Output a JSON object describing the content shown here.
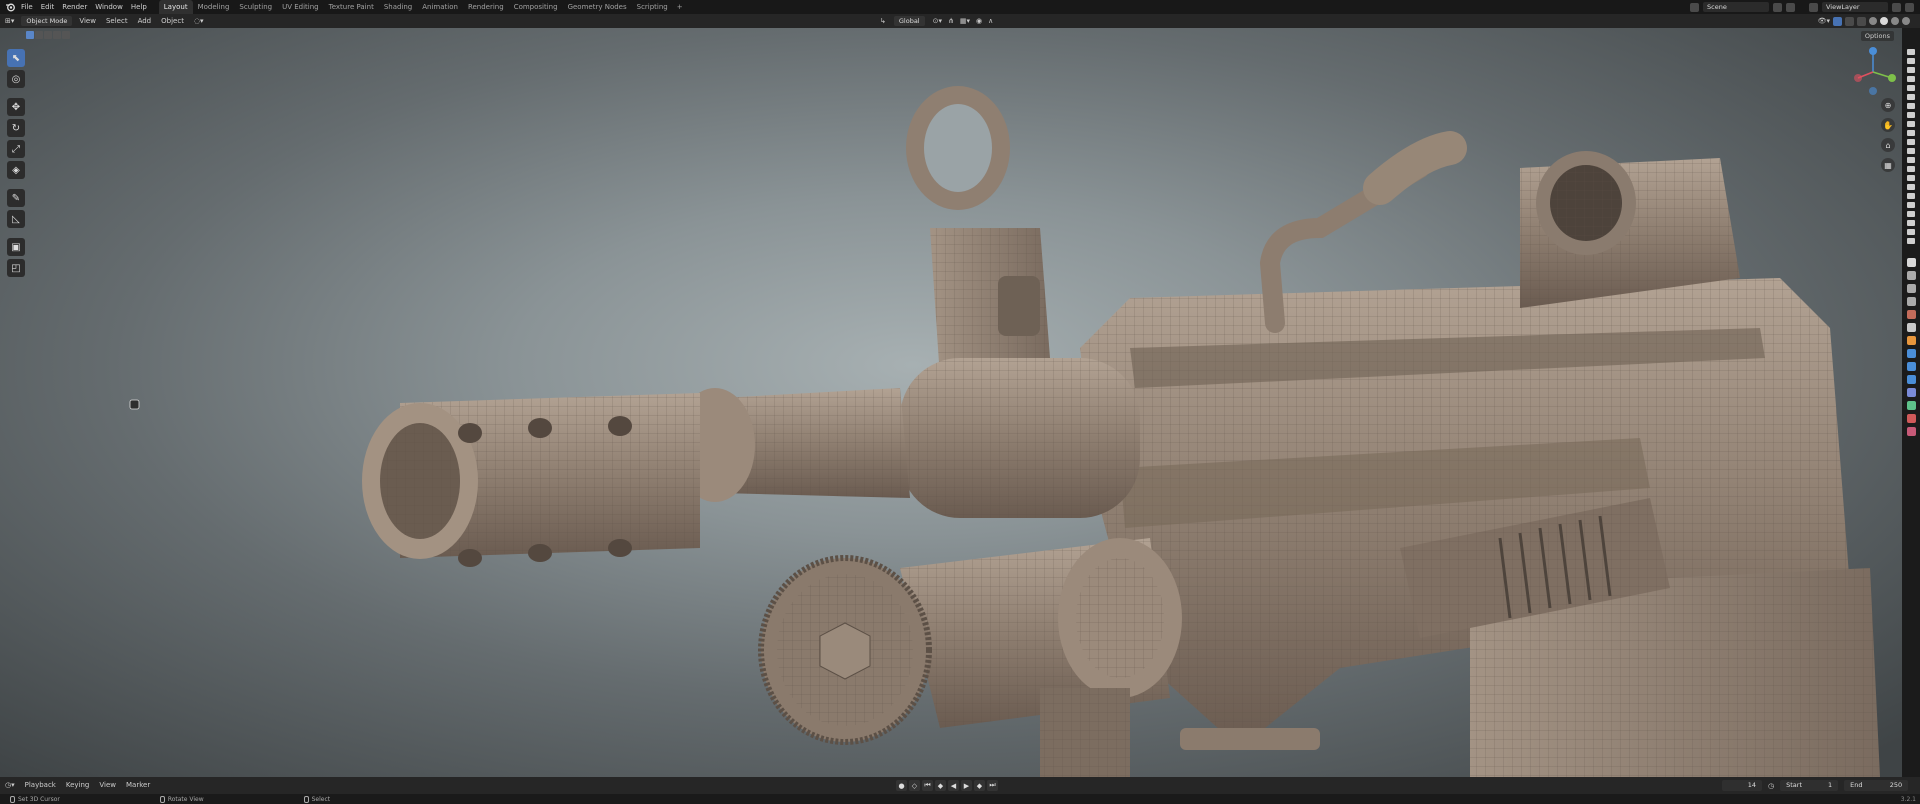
{
  "topbar": {
    "menus": [
      "File",
      "Edit",
      "Render",
      "Window",
      "Help"
    ],
    "workspaces": [
      "Layout",
      "Modeling",
      "Sculpting",
      "UV Editing",
      "Texture Paint",
      "Shading",
      "Animation",
      "Rendering",
      "Compositing",
      "Geometry Nodes",
      "Scripting"
    ],
    "active_workspace": "Layout",
    "add_tab": "+",
    "scene": "Scene",
    "view_layer": "ViewLayer"
  },
  "header": {
    "mode": "Object Mode",
    "menus": [
      "View",
      "Select",
      "Add",
      "Object"
    ],
    "orientation": "Global"
  },
  "viewport": {
    "options_label": "Options",
    "gizmo_axes": {
      "x": "#e0505f",
      "y": "#7ec04a",
      "z": "#4a8ed8"
    }
  },
  "toolbar": {
    "tools": [
      "select-box",
      "cursor",
      "move",
      "rotate",
      "scale",
      "transform",
      "annotate",
      "measure",
      "add-cube",
      "transform-cage"
    ]
  },
  "timeline": {
    "menus": [
      "Playback",
      "Keying",
      "View",
      "Marker"
    ],
    "current_frame": "14",
    "start_label": "Start",
    "start": "1",
    "end_label": "End",
    "end": "250"
  },
  "statusbar": {
    "items": [
      "Set 3D Cursor",
      "Rotate View",
      "Select"
    ],
    "version": "3.2.1"
  },
  "colors": {
    "accent": "#4772b3",
    "model": "#8c7c6e"
  }
}
